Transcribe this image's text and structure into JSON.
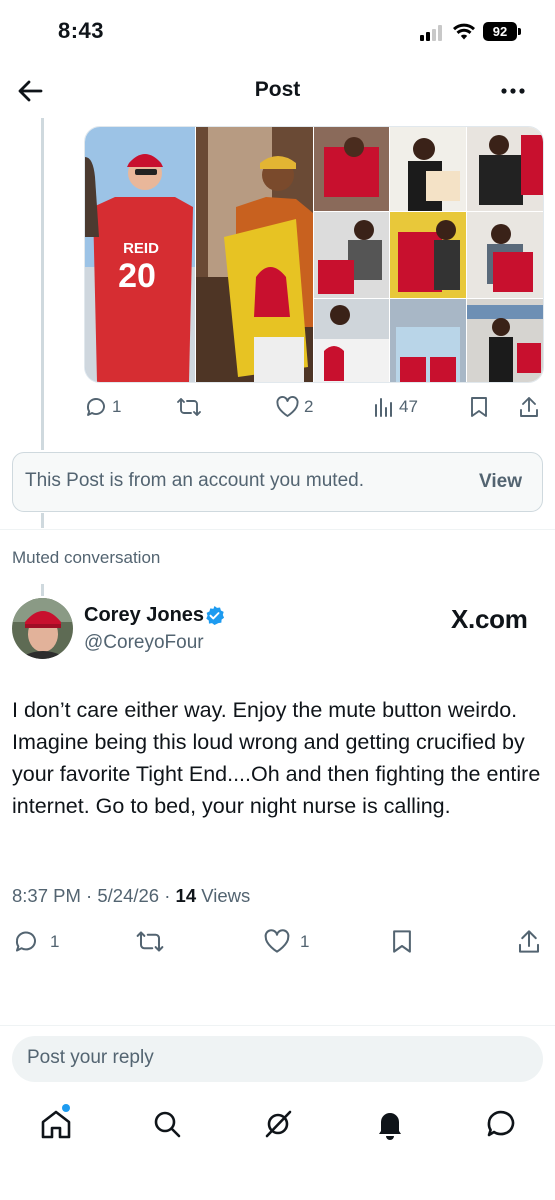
{
  "status_bar": {
    "time": "8:43",
    "battery": "92"
  },
  "nav": {
    "title": "Post"
  },
  "parent_post": {
    "stats": {
      "replies": "1",
      "retweets": "",
      "likes": "2",
      "views": "47"
    }
  },
  "muted_notice": {
    "text": "This Post is from an account you muted.",
    "view_label": "View"
  },
  "muted_conversation_label": "Muted conversation",
  "post": {
    "author_name": "Corey Jones",
    "author_handle": "@CoreyoFour",
    "watermark": "X.com",
    "text": "I don’t care either way. Enjoy the mute button weirdo. Imagine being this loud wrong and getting crucified by your favorite Tight End....Oh and then fighting the entire internet. Go to bed, your night nurse is calling.",
    "time": "8:37 PM",
    "date": "5/24/26",
    "views_count": "14",
    "views_label": "Views",
    "stats": {
      "replies": "1",
      "retweets": "",
      "likes": "1"
    }
  },
  "reply": {
    "placeholder": "Post your reply"
  },
  "media": {
    "jersey_text": "REID",
    "jersey_number": "20"
  },
  "colors": {
    "accent": "#1d9bf0",
    "secondary_text": "#536471",
    "chiefs_red": "#d62d32"
  }
}
